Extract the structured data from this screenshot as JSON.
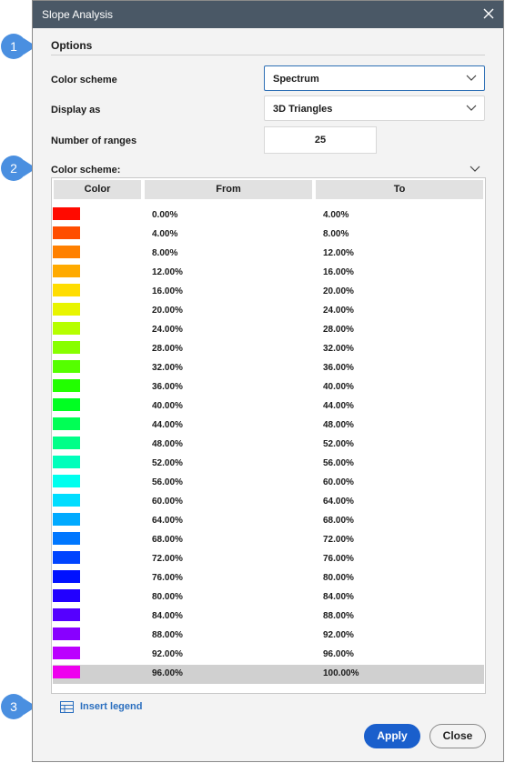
{
  "window": {
    "title": "Slope Analysis"
  },
  "options": {
    "section_title": "Options",
    "color_scheme_label": "Color scheme",
    "color_scheme_value": "Spectrum",
    "display_as_label": "Display as",
    "display_as_value": "3D Triangles",
    "ranges_label": "Number of ranges",
    "ranges_value": "25"
  },
  "scheme": {
    "title": "Color scheme:",
    "headers": {
      "color": "Color",
      "from": "From",
      "to": "To"
    },
    "selected_index": 24,
    "rows": [
      {
        "color": "#ff0a00",
        "from": "0.00%",
        "to": "4.00%"
      },
      {
        "color": "#ff4d00",
        "from": "4.00%",
        "to": "8.00%"
      },
      {
        "color": "#ff8000",
        "from": "8.00%",
        "to": "12.00%"
      },
      {
        "color": "#ffaa00",
        "from": "12.00%",
        "to": "16.00%"
      },
      {
        "color": "#ffdd00",
        "from": "16.00%",
        "to": "20.00%"
      },
      {
        "color": "#e8f500",
        "from": "20.00%",
        "to": "24.00%"
      },
      {
        "color": "#b6ff00",
        "from": "24.00%",
        "to": "28.00%"
      },
      {
        "color": "#88ff00",
        "from": "28.00%",
        "to": "32.00%"
      },
      {
        "color": "#55ff00",
        "from": "32.00%",
        "to": "36.00%"
      },
      {
        "color": "#22ff00",
        "from": "36.00%",
        "to": "40.00%"
      },
      {
        "color": "#00ff22",
        "from": "40.00%",
        "to": "44.00%"
      },
      {
        "color": "#00ff55",
        "from": "44.00%",
        "to": "48.00%"
      },
      {
        "color": "#00ff88",
        "from": "48.00%",
        "to": "52.00%"
      },
      {
        "color": "#00ffbb",
        "from": "52.00%",
        "to": "56.00%"
      },
      {
        "color": "#00ffee",
        "from": "56.00%",
        "to": "60.00%"
      },
      {
        "color": "#00ddff",
        "from": "60.00%",
        "to": "64.00%"
      },
      {
        "color": "#00aaff",
        "from": "64.00%",
        "to": "68.00%"
      },
      {
        "color": "#0077ff",
        "from": "68.00%",
        "to": "72.00%"
      },
      {
        "color": "#0044ff",
        "from": "72.00%",
        "to": "76.00%"
      },
      {
        "color": "#0011ff",
        "from": "76.00%",
        "to": "80.00%"
      },
      {
        "color": "#2200ff",
        "from": "80.00%",
        "to": "84.00%"
      },
      {
        "color": "#5500ff",
        "from": "84.00%",
        "to": "88.00%"
      },
      {
        "color": "#8800ff",
        "from": "88.00%",
        "to": "92.00%"
      },
      {
        "color": "#bb00ff",
        "from": "92.00%",
        "to": "96.00%"
      },
      {
        "color": "#ee00ee",
        "from": "96.00%",
        "to": "100.00%"
      }
    ]
  },
  "footer": {
    "insert_legend_label": "Insert legend",
    "apply_label": "Apply",
    "close_label": "Close"
  },
  "callouts": [
    "1",
    "2",
    "3"
  ],
  "icons": {
    "close": "close-icon",
    "chevron": "chevron-down-icon",
    "legend": "table-icon"
  },
  "colors": {
    "titlebar": "#4a5866",
    "accent": "#1a5fcc",
    "link": "#2b6fbf",
    "callout": "#4a8fe0"
  }
}
